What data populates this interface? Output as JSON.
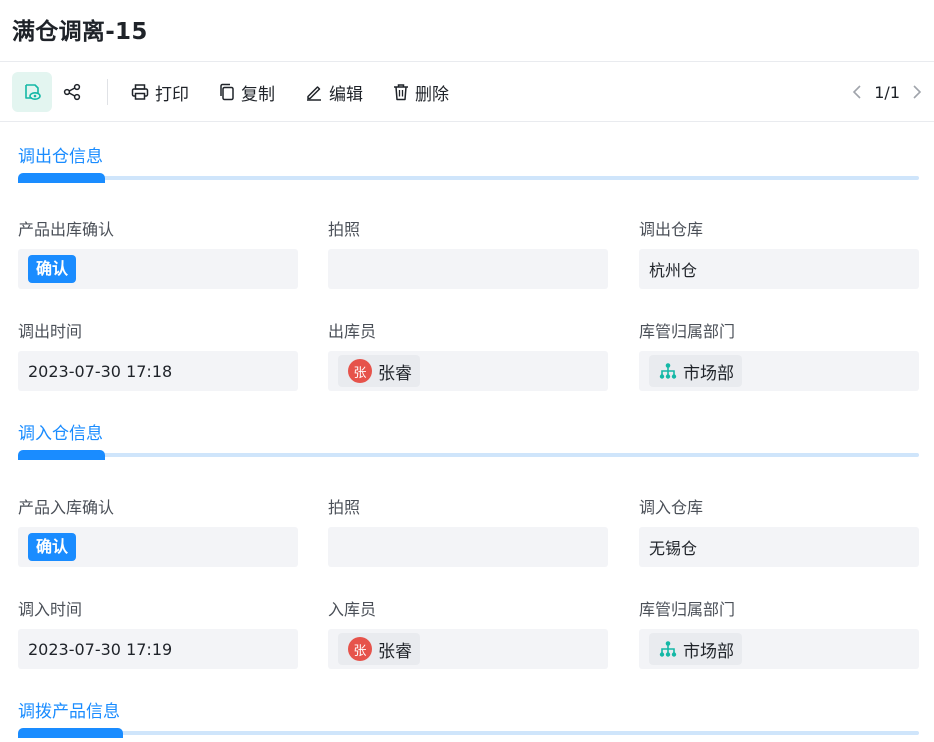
{
  "page": {
    "title": "满仓调离-15"
  },
  "toolbar": {
    "print_label": "打印",
    "copy_label": "复制",
    "edit_label": "编辑",
    "delete_label": "删除",
    "pager_text": "1/1"
  },
  "out_section": {
    "title": "调出仓信息",
    "confirm_label": "产品出库确认",
    "confirm_value": "确认",
    "photo_label": "拍照",
    "warehouse_label": "调出仓库",
    "warehouse_value": "杭州仓",
    "time_label": "调出时间",
    "time_value": "2023-07-30 17:18",
    "clerk_label": "出库员",
    "clerk_avatar": "张",
    "clerk_name": "张睿",
    "dept_label": "库管归属部门",
    "dept_value": "市场部"
  },
  "in_section": {
    "title": "调入仓信息",
    "confirm_label": "产品入库确认",
    "confirm_value": "确认",
    "photo_label": "拍照",
    "warehouse_label": "调入仓库",
    "warehouse_value": "无锡仓",
    "time_label": "调入时间",
    "time_value": "2023-07-30 17:19",
    "clerk_label": "入库员",
    "clerk_avatar": "张",
    "clerk_name": "张睿",
    "dept_label": "库管归属部门",
    "dept_value": "市场部"
  },
  "product_section": {
    "title": "调拨产品信息"
  },
  "colors": {
    "accent": "#1a8cff",
    "accent_light": "#cfe5fb",
    "teal": "#14b8a6",
    "avatar": "#e6534b",
    "field_bg": "#f3f4f7"
  },
  "icons": [
    "view-icon",
    "share-icon",
    "printer-icon",
    "copy-icon",
    "edit-icon",
    "trash-icon",
    "chevron-left-icon",
    "chevron-right-icon",
    "org-tree-icon"
  ]
}
